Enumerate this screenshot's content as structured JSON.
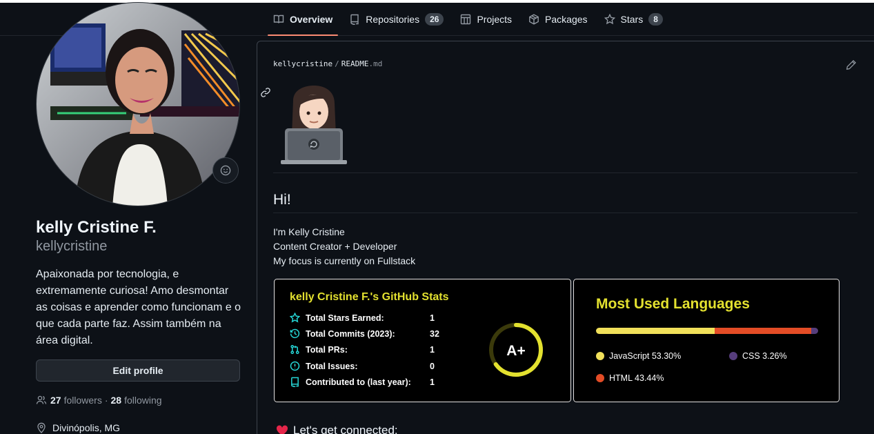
{
  "tabs": [
    {
      "label": "Overview",
      "icon": "book-icon",
      "active": true
    },
    {
      "label": "Repositories",
      "icon": "repo-icon",
      "count": "26"
    },
    {
      "label": "Projects",
      "icon": "table-icon"
    },
    {
      "label": "Packages",
      "icon": "package-icon"
    },
    {
      "label": "Stars",
      "icon": "star-icon",
      "count": "8"
    }
  ],
  "profile": {
    "name": "kelly Cristine F.",
    "login": "kellycristine",
    "bio": "Apaixonada por tecnologia, e extremamente curiosa! Amo desmontar as coisas e aprender como funcionam e o que cada parte faz. Assim também na área digital.",
    "edit_label": "Edit profile",
    "followers_count": "27",
    "followers_label": "followers",
    "separator": "·",
    "following_count": "28",
    "following_label": "following",
    "location": "Divinópolis, MG"
  },
  "readme": {
    "owner": "kellycristine",
    "sep": "/",
    "file": "README",
    "ext": ".md",
    "heading": "Hi!",
    "lines": [
      "I'm Kelly Cristine",
      "Content Creator + Developer",
      "My focus is currently on Fullstack"
    ],
    "connect": "Let's get connected:"
  },
  "stats_card": {
    "title": "kelly Cristine F.'s GitHub Stats",
    "rows": [
      {
        "label": "Total Stars Earned:",
        "value": "1",
        "icon": "star-icon"
      },
      {
        "label": "Total Commits (2023):",
        "value": "32",
        "icon": "history-icon"
      },
      {
        "label": "Total PRs:",
        "value": "1",
        "icon": "pull-request-icon"
      },
      {
        "label": "Total Issues:",
        "value": "0",
        "icon": "issue-icon"
      },
      {
        "label": "Contributed to (last year):",
        "value": "1",
        "icon": "repo-icon"
      }
    ],
    "rank": "A+",
    "rank_progress": 0.65,
    "colors": {
      "title": "#e3e12f",
      "icon": "#26d6d6",
      "ring": "#e3e12f"
    }
  },
  "langs_card": {
    "title": "Most Used Languages",
    "languages": [
      {
        "name": "JavaScript",
        "percent": 53.3,
        "label": "JavaScript 53.30%",
        "color": "#f1e05a"
      },
      {
        "name": "HTML",
        "percent": 43.44,
        "label": "HTML 43.44%",
        "color": "#e34c26"
      },
      {
        "name": "CSS",
        "percent": 3.26,
        "label": "CSS 3.26%",
        "color": "#563d7c"
      }
    ]
  }
}
